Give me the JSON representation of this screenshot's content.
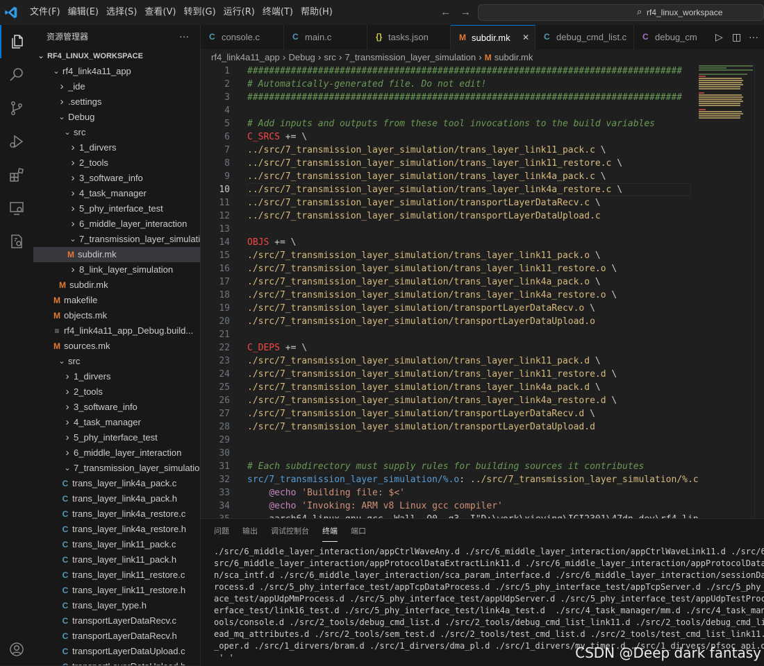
{
  "titlebar": {
    "menu": [
      "文件(F)",
      "编辑(E)",
      "选择(S)",
      "查看(V)",
      "转到(G)",
      "运行(R)",
      "终端(T)",
      "帮助(H)"
    ],
    "search_text": "rf4_linux_workspace"
  },
  "sidebar": {
    "title": "资源管理器",
    "tree": [
      {
        "label": "RF4_LINUX_WORKSPACE",
        "depth": 0,
        "kind": "root",
        "open": true
      },
      {
        "label": "rf4_link4a11_app",
        "depth": 1,
        "kind": "folder",
        "open": true
      },
      {
        "label": "_ide",
        "depth": 2,
        "kind": "folder",
        "open": false
      },
      {
        "label": ".settings",
        "depth": 2,
        "kind": "folder",
        "open": false
      },
      {
        "label": "Debug",
        "depth": 2,
        "kind": "folder",
        "open": true
      },
      {
        "label": "src",
        "depth": 3,
        "kind": "folder",
        "open": true
      },
      {
        "label": "1_dirvers",
        "depth": 4,
        "kind": "folder",
        "open": false
      },
      {
        "label": "2_tools",
        "depth": 4,
        "kind": "folder",
        "open": false
      },
      {
        "label": "3_software_info",
        "depth": 4,
        "kind": "folder",
        "open": false
      },
      {
        "label": "4_task_manager",
        "depth": 4,
        "kind": "folder",
        "open": false
      },
      {
        "label": "5_phy_interface_test",
        "depth": 4,
        "kind": "folder",
        "open": false
      },
      {
        "label": "6_middle_layer_interaction",
        "depth": 4,
        "kind": "folder",
        "open": false
      },
      {
        "label": "7_transmission_layer_simulation",
        "depth": 4,
        "kind": "folder",
        "open": true
      },
      {
        "label": "subdir.mk",
        "depth": 5,
        "kind": "m",
        "selected": true
      },
      {
        "label": "8_link_layer_simulation",
        "depth": 4,
        "kind": "folder",
        "open": false
      },
      {
        "label": "subdir.mk",
        "depth": 4,
        "kind": "m"
      },
      {
        "label": "makefile",
        "depth": 3,
        "kind": "m"
      },
      {
        "label": "objects.mk",
        "depth": 3,
        "kind": "m"
      },
      {
        "label": "rf4_link4a11_app_Debug.build...",
        "depth": 3,
        "kind": "file"
      },
      {
        "label": "sources.mk",
        "depth": 3,
        "kind": "m"
      },
      {
        "label": "src",
        "depth": 2,
        "kind": "folder",
        "open": true
      },
      {
        "label": "1_dirvers",
        "depth": 3,
        "kind": "folder",
        "open": false
      },
      {
        "label": "2_tools",
        "depth": 3,
        "kind": "folder",
        "open": false
      },
      {
        "label": "3_software_info",
        "depth": 3,
        "kind": "folder",
        "open": false
      },
      {
        "label": "4_task_manager",
        "depth": 3,
        "kind": "folder",
        "open": false
      },
      {
        "label": "5_phy_interface_test",
        "depth": 3,
        "kind": "folder",
        "open": false
      },
      {
        "label": "6_middle_layer_interaction",
        "depth": 3,
        "kind": "folder",
        "open": false
      },
      {
        "label": "7_transmission_layer_simulation",
        "depth": 3,
        "kind": "folder",
        "open": true
      },
      {
        "label": "trans_layer_link4a_pack.c",
        "depth": 4,
        "kind": "c"
      },
      {
        "label": "trans_layer_link4a_pack.h",
        "depth": 4,
        "kind": "c"
      },
      {
        "label": "trans_layer_link4a_restore.c",
        "depth": 4,
        "kind": "c"
      },
      {
        "label": "trans_layer_link4a_restore.h",
        "depth": 4,
        "kind": "c"
      },
      {
        "label": "trans_layer_link11_pack.c",
        "depth": 4,
        "kind": "c"
      },
      {
        "label": "trans_layer_link11_pack.h",
        "depth": 4,
        "kind": "c"
      },
      {
        "label": "trans_layer_link11_restore.c",
        "depth": 4,
        "kind": "c"
      },
      {
        "label": "trans_layer_link11_restore.h",
        "depth": 4,
        "kind": "c"
      },
      {
        "label": "trans_layer_type.h",
        "depth": 4,
        "kind": "c"
      },
      {
        "label": "transportLayerDataRecv.c",
        "depth": 4,
        "kind": "c"
      },
      {
        "label": "transportLayerDataRecv.h",
        "depth": 4,
        "kind": "c"
      },
      {
        "label": "transportLayerDataUpload.c",
        "depth": 4,
        "kind": "c"
      },
      {
        "label": "transportLayerDataUpload.h",
        "depth": 4,
        "kind": "c"
      }
    ]
  },
  "tabs": [
    {
      "label": "console.c",
      "icon": "C",
      "kind": "c"
    },
    {
      "label": "main.c",
      "icon": "C",
      "kind": "c"
    },
    {
      "label": "tasks.json",
      "icon": "{}",
      "kind": "json"
    },
    {
      "label": "subdir.mk",
      "icon": "M",
      "kind": "m",
      "active": true
    },
    {
      "label": "debug_cmd_list.c",
      "icon": "C",
      "kind": "c"
    },
    {
      "label": "debug_cm",
      "icon": "C",
      "kind": "cpurple"
    }
  ],
  "breadcrumb": [
    "rf4_link4a11_app",
    "Debug",
    "src",
    "7_transmission_layer_simulation",
    "subdir.mk"
  ],
  "editor": {
    "current_line": 10,
    "lines": [
      {
        "n": "1",
        "segs": [
          [
            "cm",
            "################################################################################"
          ]
        ]
      },
      {
        "n": "2",
        "segs": [
          [
            "cm",
            "# Automatically-generated file. Do not edit!"
          ]
        ]
      },
      {
        "n": "3",
        "segs": [
          [
            "cm",
            "################################################################################"
          ]
        ]
      },
      {
        "n": "4",
        "segs": []
      },
      {
        "n": "5",
        "segs": [
          [
            "cm",
            "# Add inputs and outputs from these tool invocations to the build variables"
          ]
        ]
      },
      {
        "n": "6",
        "segs": [
          [
            "var",
            "C_SRCS"
          ],
          [
            "op",
            " += \\"
          ]
        ]
      },
      {
        "n": "7",
        "segs": [
          [
            "path",
            "../src/7_transmission_layer_simulation/trans_layer_link11_pack.c"
          ],
          [
            "op",
            " \\"
          ]
        ]
      },
      {
        "n": "8",
        "segs": [
          [
            "path",
            "../src/7_transmission_layer_simulation/trans_layer_link11_restore.c"
          ],
          [
            "op",
            " \\"
          ]
        ]
      },
      {
        "n": "9",
        "segs": [
          [
            "path",
            "../src/7_transmission_layer_simulation/trans_layer_link4a_pack.c"
          ],
          [
            "op",
            " \\"
          ]
        ]
      },
      {
        "n": "10",
        "segs": [
          [
            "path",
            "../src/7_transmission_layer_simulation/trans_layer_link4a_restore.c"
          ],
          [
            "op",
            " \\"
          ]
        ]
      },
      {
        "n": "11",
        "segs": [
          [
            "path",
            "../src/7_transmission_layer_simulation/transportLayerDataRecv.c"
          ],
          [
            "op",
            " \\"
          ]
        ]
      },
      {
        "n": "12",
        "segs": [
          [
            "path",
            "../src/7_transmission_layer_simulation/transportLayerDataUpload.c"
          ]
        ]
      },
      {
        "n": "13",
        "segs": []
      },
      {
        "n": "14",
        "segs": [
          [
            "var",
            "OBJS"
          ],
          [
            "op",
            " += \\"
          ]
        ]
      },
      {
        "n": "15",
        "segs": [
          [
            "path",
            "./src/7_transmission_layer_simulation/trans_layer_link11_pack.o"
          ],
          [
            "op",
            " \\"
          ]
        ]
      },
      {
        "n": "16",
        "segs": [
          [
            "path",
            "./src/7_transmission_layer_simulation/trans_layer_link11_restore.o"
          ],
          [
            "op",
            " \\"
          ]
        ]
      },
      {
        "n": "17",
        "segs": [
          [
            "path",
            "./src/7_transmission_layer_simulation/trans_layer_link4a_pack.o"
          ],
          [
            "op",
            " \\"
          ]
        ]
      },
      {
        "n": "18",
        "segs": [
          [
            "path",
            "./src/7_transmission_layer_simulation/trans_layer_link4a_restore.o"
          ],
          [
            "op",
            " \\"
          ]
        ]
      },
      {
        "n": "19",
        "segs": [
          [
            "path",
            "./src/7_transmission_layer_simulation/transportLayerDataRecv.o"
          ],
          [
            "op",
            " \\"
          ]
        ]
      },
      {
        "n": "20",
        "segs": [
          [
            "path",
            "./src/7_transmission_layer_simulation/transportLayerDataUpload.o"
          ]
        ]
      },
      {
        "n": "21",
        "segs": []
      },
      {
        "n": "22",
        "segs": [
          [
            "var",
            "C_DEPS"
          ],
          [
            "op",
            " += \\"
          ]
        ]
      },
      {
        "n": "23",
        "segs": [
          [
            "path",
            "./src/7_transmission_layer_simulation/trans_layer_link11_pack.d"
          ],
          [
            "op",
            " \\"
          ]
        ]
      },
      {
        "n": "24",
        "segs": [
          [
            "path",
            "./src/7_transmission_layer_simulation/trans_layer_link11_restore.d"
          ],
          [
            "op",
            " \\"
          ]
        ]
      },
      {
        "n": "25",
        "segs": [
          [
            "path",
            "./src/7_transmission_layer_simulation/trans_layer_link4a_pack.d"
          ],
          [
            "op",
            " \\"
          ]
        ]
      },
      {
        "n": "26",
        "segs": [
          [
            "path",
            "./src/7_transmission_layer_simulation/trans_layer_link4a_restore.d"
          ],
          [
            "op",
            " \\"
          ]
        ]
      },
      {
        "n": "27",
        "segs": [
          [
            "path",
            "./src/7_transmission_layer_simulation/transportLayerDataRecv.d"
          ],
          [
            "op",
            " \\"
          ]
        ]
      },
      {
        "n": "28",
        "segs": [
          [
            "path",
            "./src/7_transmission_layer_simulation/transportLayerDataUpload.d"
          ]
        ]
      },
      {
        "n": "29",
        "segs": []
      },
      {
        "n": "30",
        "segs": []
      },
      {
        "n": "31",
        "segs": [
          [
            "cm",
            "# Each subdirectory must supply rules for building sources it contributes"
          ]
        ]
      },
      {
        "n": "32",
        "segs": [
          [
            "bl",
            "src/7_transmission_layer_simulation/%.o"
          ],
          [
            "op",
            ": "
          ],
          [
            "path",
            "../src/7_transmission_layer_simulation/%.c"
          ]
        ]
      },
      {
        "n": "33",
        "segs": [
          [
            "op",
            "    "
          ],
          [
            "fn",
            "@echo"
          ],
          [
            "str",
            " 'Building file: $<'"
          ]
        ]
      },
      {
        "n": "34",
        "segs": [
          [
            "op",
            "    "
          ],
          [
            "fn",
            "@echo"
          ],
          [
            "str",
            " 'Invoking: ARM v8 Linux gcc compiler'"
          ]
        ]
      },
      {
        "n": "35",
        "segs": [
          [
            "op",
            "    aarch64-linux-gnu-gcc -Wall -O0 -g3 -I\"D:\\work\\xieying\\IGI2301\\47dn-dev\\rf4_lin"
          ]
        ]
      }
    ]
  },
  "panel": {
    "tabs": [
      "问题",
      "输出",
      "调试控制台",
      "终端",
      "端口"
    ],
    "active_tab": "终端",
    "terminal_lines": [
      "./src/6_middle_layer_interaction/appCtrlWaveAny.d ./src/6_middle_layer_interaction/appCtrlWaveLink11.d ./src/6_mi",
      "src/6_middle_layer_interaction/appProtocolDataExtractLink11.d ./src/6_middle_layer_interaction/appProtocolDataExt",
      "n/sca_intf.d ./src/6_middle_layer_interaction/sca_param_interface.d ./src/6_middle_layer_interaction/sessionDataR",
      "rocess.d ./src/5_phy_interface_test/appTcpDataProcess.d ./src/5_phy_interface_test/appTcpServer.d ./src/5_phy_int",
      "ace_test/appUdpMmProcess.d ./src/5_phy_interface_test/appUdpServer.d ./src/5_phy_interface_test/appUdpTestProcess",
      "erface_test/link16_test.d ./src/5_phy_interface_test/link4a_test.d  ./src/4_task_manager/mm.d ./src/4_task_manage",
      "ools/console.d ./src/2_tools/debug_cmd_list.d ./src/2_tools/debug_cmd_list_link11.d ./src/2_tools/debug_cmd_list_",
      "ead_mq_attributes.d ./src/2_tools/sem_test.d ./src/2_tools/test_cmd_list.d ./src/2_tools/test_cmd_list_link11.d .",
      "_oper.d ./src/1_dirvers/bram.d ./src/1_dirvers/dma_pl.d ./src/1_dirvers/my_timer.d ./src/1_dirvers/pfsoc_api.d",
      " ' '"
    ]
  },
  "watermark": "CSDN @Deep dark fantasy",
  "colors": {
    "accent": "#0078d4",
    "m_icon": "#e37933",
    "c_icon": "#519aba",
    "json_icon": "#cbcb41"
  }
}
